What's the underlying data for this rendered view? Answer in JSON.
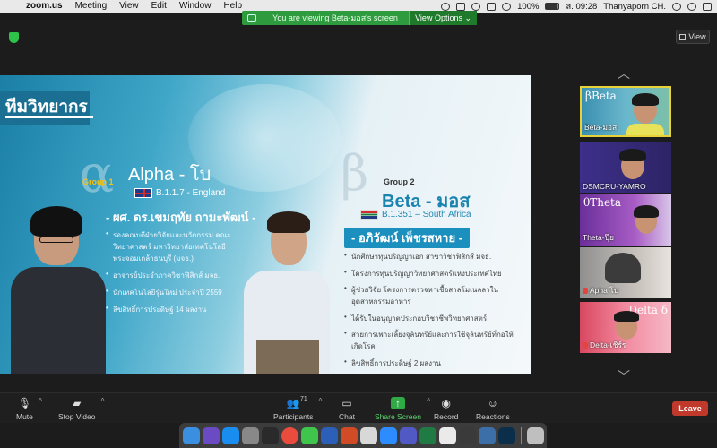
{
  "menubar": {
    "app": "zoom.us",
    "items": [
      "Meeting",
      "View",
      "Edit",
      "Window",
      "Help"
    ],
    "battery": "100%",
    "datetime": "ส. 09:28",
    "user": "Thanyaporn CH."
  },
  "banner": {
    "text": "You are viewing Beta-มอส's screen",
    "view_options": "View Options ⌄"
  },
  "view_button": "View",
  "slide": {
    "topic": "ทีมวิทยากร",
    "alpha": {
      "group": "Group 1",
      "name": "Alpha - โบ",
      "variant": "B.1.1.7 - England",
      "person": "- ผศ. ดร.เขมฤทัย ถามะพัฒน์ -",
      "bullets": [
        "รองคณบดีฝ่ายวิจัยและนวัตกรรม คณะวิทยาศาสตร์ มหาวิทยาลัยเทคโนโลยีพระจอมเกล้าธนบุรี (มจธ.)",
        "อาจารย์ประจำภาควิชาฟิสิกส์ มจธ.",
        "นักเทคโนโลยีรุ่นใหม่ ประจำปี 2559",
        "ลิขสิทธิ์การประดิษฐ์ 14 ผลงาน"
      ]
    },
    "beta": {
      "group": "Group 2",
      "name": "Beta - มอส",
      "variant": "B.1.351 – South Africa",
      "person": "- อภิวัฒน์ เพ็ชรสหาย -",
      "bullets": [
        "นักศึกษาทุนปริญญาเอก สาขาวิชาฟิสิกส์ มจธ.",
        "โครงการทุนปริญญาวิทยาศาสตร์แห่งประเทศไทย",
        "ผู้ช่วยวิจัย โครงการตรวจหาเชื้อสาลโมเนลลาในอุตสาหกรรมอาหาร",
        "ได้รับในอนุญาตประกอบวิชาชีพวิทยาศาสตร์",
        "สายการเพาะเลี้ยงจุลินทรีย์และการใช้จุลินทรีย์ที่ก่อให้เกิดโรค",
        "ลิขสิทธิ์การประดิษฐ์ 2 ผลงาน"
      ]
    }
  },
  "participants_panel": [
    {
      "name": "Beta-มอส",
      "label": "βBeta",
      "active": true,
      "muted": false
    },
    {
      "name": "DSMCRU-YAMRO",
      "label": "",
      "active": false,
      "muted": false
    },
    {
      "name": "Theta-ปุ๊ย",
      "label": "θTheta",
      "active": false,
      "muted": false
    },
    {
      "name": "Apha โบ",
      "label": "",
      "active": false,
      "muted": true
    },
    {
      "name": "Delta-เชิร์ร",
      "label": "Delta δ",
      "active": false,
      "muted": true
    }
  ],
  "toolbar": {
    "mute": "Mute",
    "stop_video": "Stop Video",
    "participants": "Participants",
    "participants_count": "71",
    "chat": "Chat",
    "share_screen": "Share Screen",
    "record": "Record",
    "reactions": "Reactions",
    "leave": "Leave"
  },
  "colors": {
    "share_green": "#2faa45",
    "leave_red": "#c0392b",
    "active_speaker": "#e8d23a",
    "banner_green": "#2e9b3e"
  }
}
